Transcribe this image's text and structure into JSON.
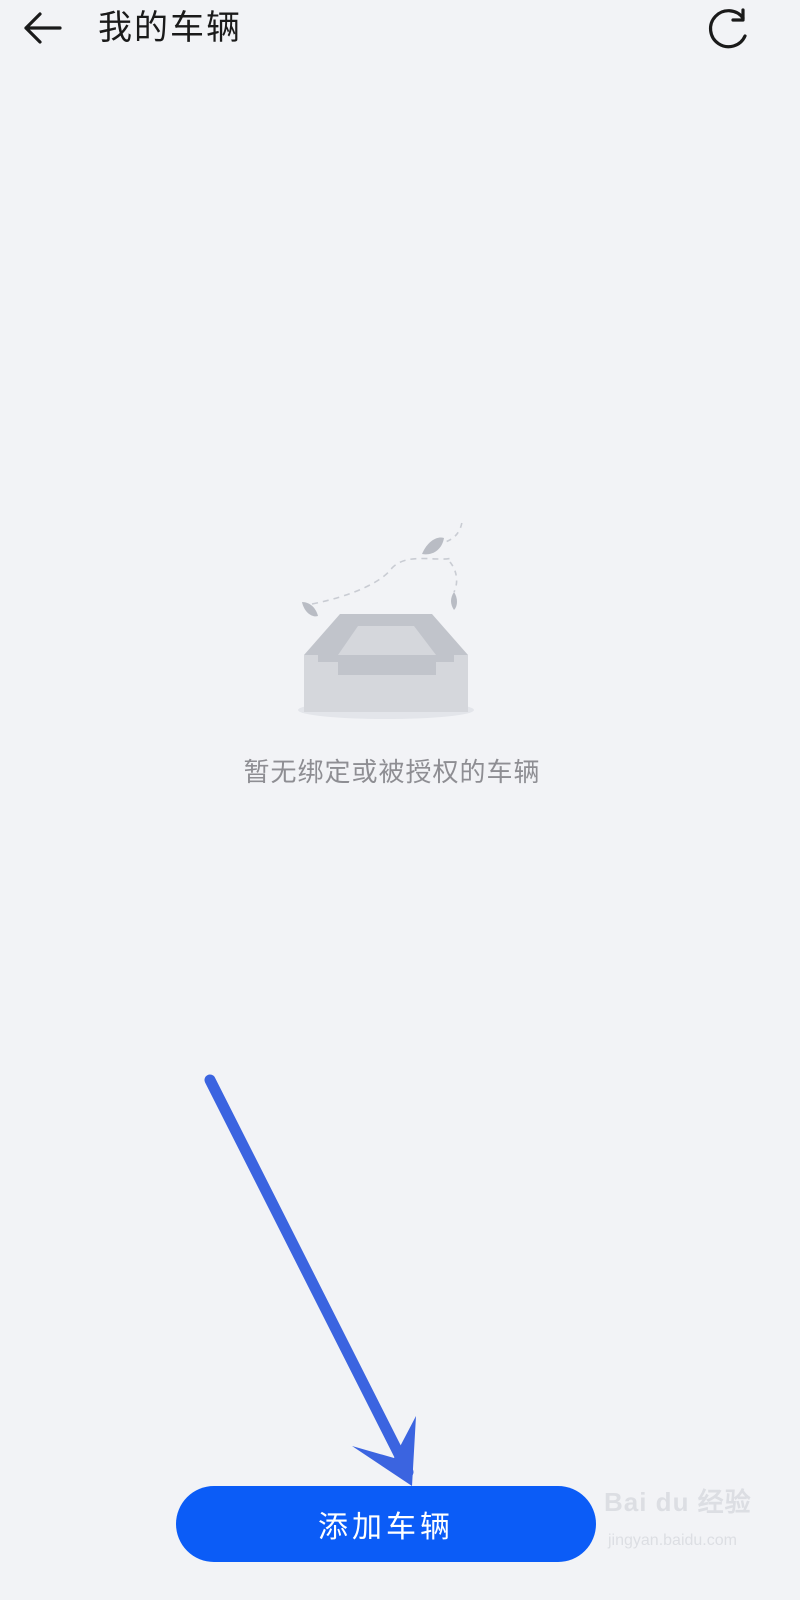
{
  "header": {
    "title": "我的车辆",
    "back_icon": "arrow-left-icon",
    "refresh_icon": "refresh-icon"
  },
  "empty_state": {
    "illustration": "empty-inbox-tray-icon",
    "message": "暂无绑定或被授权的车辆"
  },
  "primary_action": {
    "label": "添加车辆",
    "color": "#0b5cf7"
  },
  "annotation": {
    "type": "arrow",
    "color": "#3b64e0"
  },
  "watermark": {
    "logo": "Bai du 经验",
    "url": "jingyan.baidu.com"
  },
  "colors": {
    "background": "#f2f3f6",
    "text_secondary": "#8e8e93"
  }
}
